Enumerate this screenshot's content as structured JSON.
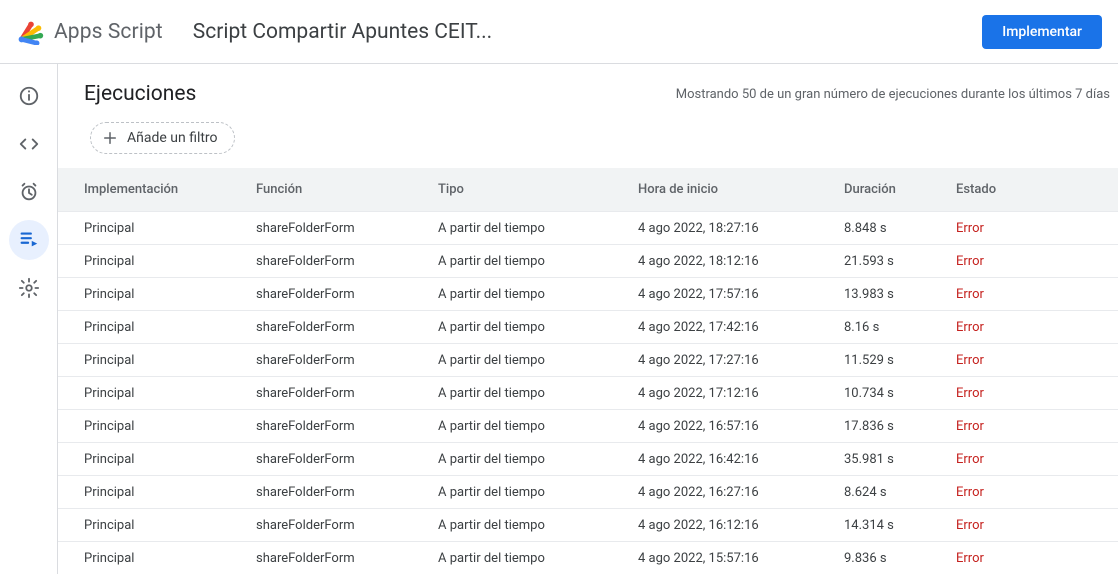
{
  "header": {
    "product": "Apps Script",
    "project": "Script Compartir Apuntes CEIT...",
    "implement": "Implementar"
  },
  "sidebar": {
    "items": [
      {
        "name": "info",
        "active": false
      },
      {
        "name": "editor",
        "active": false
      },
      {
        "name": "triggers",
        "active": false
      },
      {
        "name": "executions",
        "active": true
      },
      {
        "name": "settings",
        "active": false
      }
    ]
  },
  "page": {
    "title": "Ejecuciones",
    "summary": "Mostrando 50 de un gran número de ejecuciones durante los últimos 7 días",
    "filter_label": "Añade un filtro"
  },
  "table": {
    "columns": {
      "impl": "Implementación",
      "func": "Función",
      "type": "Tipo",
      "start": "Hora de inicio",
      "dur": "Duración",
      "status": "Estado"
    },
    "rows": [
      {
        "impl": "Principal",
        "func": "shareFolderForm",
        "type": "A partir del tiempo",
        "start": "4 ago 2022, 18:27:16",
        "dur": "8.848 s",
        "status": "Error"
      },
      {
        "impl": "Principal",
        "func": "shareFolderForm",
        "type": "A partir del tiempo",
        "start": "4 ago 2022, 18:12:16",
        "dur": "21.593 s",
        "status": "Error"
      },
      {
        "impl": "Principal",
        "func": "shareFolderForm",
        "type": "A partir del tiempo",
        "start": "4 ago 2022, 17:57:16",
        "dur": "13.983 s",
        "status": "Error"
      },
      {
        "impl": "Principal",
        "func": "shareFolderForm",
        "type": "A partir del tiempo",
        "start": "4 ago 2022, 17:42:16",
        "dur": "8.16 s",
        "status": "Error"
      },
      {
        "impl": "Principal",
        "func": "shareFolderForm",
        "type": "A partir del tiempo",
        "start": "4 ago 2022, 17:27:16",
        "dur": "11.529 s",
        "status": "Error"
      },
      {
        "impl": "Principal",
        "func": "shareFolderForm",
        "type": "A partir del tiempo",
        "start": "4 ago 2022, 17:12:16",
        "dur": "10.734 s",
        "status": "Error"
      },
      {
        "impl": "Principal",
        "func": "shareFolderForm",
        "type": "A partir del tiempo",
        "start": "4 ago 2022, 16:57:16",
        "dur": "17.836 s",
        "status": "Error"
      },
      {
        "impl": "Principal",
        "func": "shareFolderForm",
        "type": "A partir del tiempo",
        "start": "4 ago 2022, 16:42:16",
        "dur": "35.981 s",
        "status": "Error"
      },
      {
        "impl": "Principal",
        "func": "shareFolderForm",
        "type": "A partir del tiempo",
        "start": "4 ago 2022, 16:27:16",
        "dur": "8.624 s",
        "status": "Error"
      },
      {
        "impl": "Principal",
        "func": "shareFolderForm",
        "type": "A partir del tiempo",
        "start": "4 ago 2022, 16:12:16",
        "dur": "14.314 s",
        "status": "Error"
      },
      {
        "impl": "Principal",
        "func": "shareFolderForm",
        "type": "A partir del tiempo",
        "start": "4 ago 2022, 15:57:16",
        "dur": "9.836 s",
        "status": "Error"
      }
    ]
  }
}
